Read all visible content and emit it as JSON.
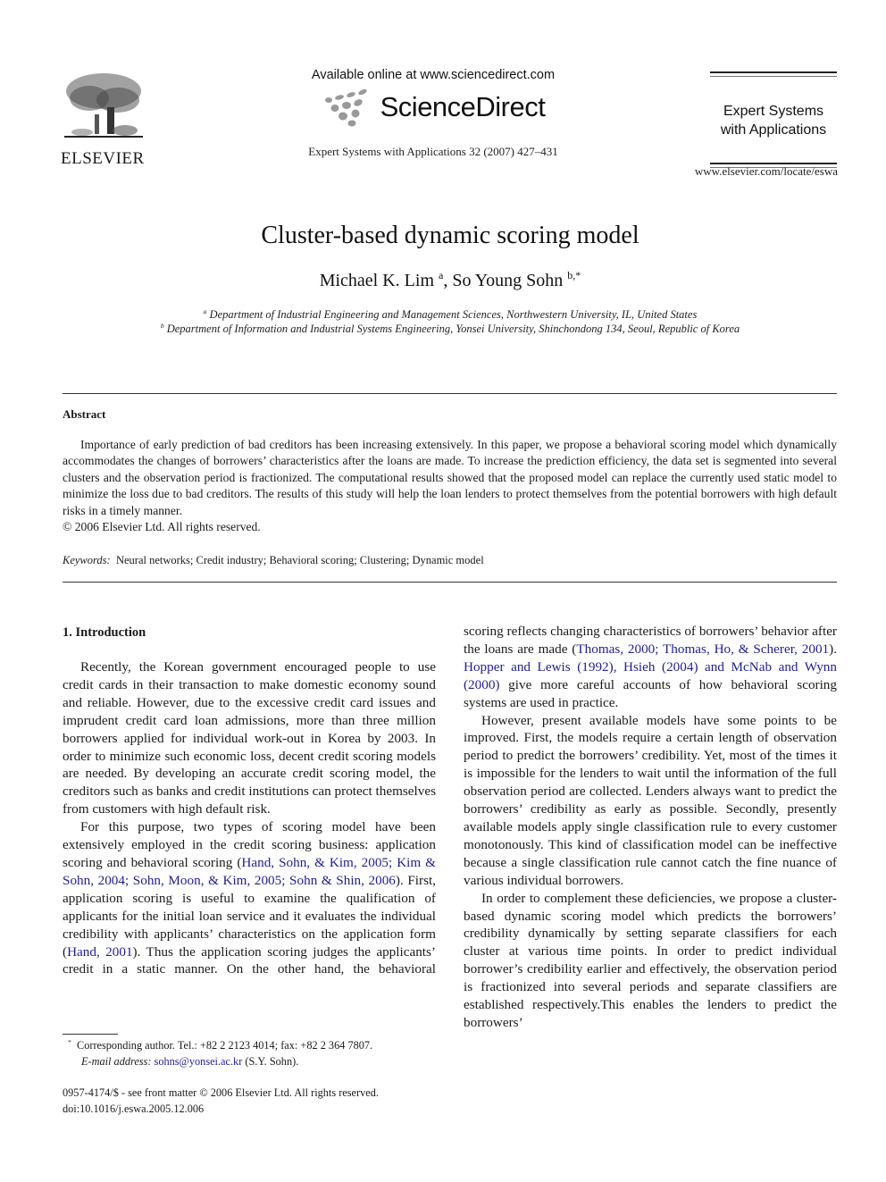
{
  "header": {
    "publisher_logo_text": "ELSEVIER",
    "logo_icon": "elsevier-tree-icon",
    "available_online": "Available online at www.sciencedirect.com",
    "sciencedirect_brand": "ScienceDirect",
    "sciencedirect_icon": "sciencedirect-dots-icon",
    "journal_citation": "Expert Systems with Applications 32 (2007) 427–431",
    "journal_title_line1": "Expert Systems",
    "journal_title_line2": "with Applications",
    "journal_url": "www.elsevier.com/locate/eswa"
  },
  "article": {
    "title": "Cluster-based dynamic scoring model",
    "authors": [
      {
        "name": "Michael K. Lim",
        "marks": "a"
      },
      {
        "name": "So Young Sohn",
        "marks": "b,*"
      }
    ],
    "author_separator": ", ",
    "affiliations": [
      {
        "mark": "a",
        "text": "Department of Industrial Engineering and Management Sciences, Northwestern University, IL, United States"
      },
      {
        "mark": "b",
        "text": "Department of Information and Industrial Systems Engineering, Yonsei University, Shinchondong 134, Seoul, Republic of Korea"
      }
    ]
  },
  "abstract": {
    "heading": "Abstract",
    "body": "Importance of early prediction of bad creditors has been increasing extensively. In this paper, we propose a behavioral scoring model which dynamically accommodates the changes of borrowers’ characteristics after the loans are made. To increase the prediction efficiency, the data set is segmented into several clusters and the observation period is fractionized. The computational results showed that the proposed model can replace the currently used static model to minimize the loss due to bad creditors. The results of this study will help the loan lenders to protect themselves from the potential borrowers with high default risks in a timely manner.",
    "copyright": "© 2006 Elsevier Ltd. All rights reserved.",
    "keywords_label": "Keywords:",
    "keywords": "Neural networks; Credit industry; Behavioral scoring; Clustering; Dynamic model"
  },
  "introduction": {
    "heading": "1. Introduction",
    "p1": "Recently, the Korean government encouraged people to use credit cards in their transaction to make domestic economy sound and reliable. However, due to the excessive credit card issues and imprudent credit card loan admissions, more than three million borrowers applied for individual work-out in Korea by 2003. In order to minimize such economic loss, decent credit scoring models are needed. By developing an accurate credit scoring model, the creditors such as banks and credit institutions can protect themselves from customers with high default risk.",
    "p2_a": "For this purpose, two types of scoring model have been extensively employed in the credit scoring business: application scoring and behavioral scoring (",
    "p2_cite1": "Hand, Sohn, & Kim, 2005; Kim & Sohn, 2004; Sohn, Moon, & Kim, 2005; Sohn & Shin, 2006",
    "p2_b": "). First, application scoring is useful to examine the qualification of applicants for the initial loan service and it evaluates the individual credibility with applicants’ characteristics on the application form (",
    "p2_cite2": "Hand, 2001",
    "p2_c": "). Thus the application scoring judges the applicants’ credit in a static manner. On the other hand, the behavioral scoring reflects changing characteristics of borrowers’ behavior after the loans are made (",
    "p2_cite3": "Thomas, 2000; Thomas, Ho, & Scherer, 2001",
    "p2_d": "). ",
    "p2_cite4": "Hopper and Lewis (1992), Hsieh (2004) and McNab and Wynn (2000)",
    "p2_e": " give more careful accounts of how behavioral scoring systems are used in practice.",
    "p3": "However, present available models have some points to be improved. First, the models require a certain length of observation period to predict the borrowers’ credibility. Yet, most of the times it is impossible for the lenders to wait until the information of the full observation period are collected. Lenders always want to predict the borrowers’ credibility as early as possible. Secondly, presently available models apply single classification rule to every customer monotonously. This kind of classification model can be ineffective because a single classification rule cannot catch the fine nuance of various individual borrowers.",
    "p4": "In order to complement these deficiencies, we propose a cluster-based dynamic scoring model which predicts the borrowers’ credibility dynamically by setting separate classifiers for each cluster at various time points. In order to predict individual borrower’s credibility earlier and effectively, the observation period is fractionized into several periods and separate classifiers are established respectively.This enables the lenders to predict the borrowers’"
  },
  "footnote": {
    "mark": "*",
    "text": "Corresponding author. Tel.: +82 2 2123 4014; fax: +82 2 364 7807.",
    "email_label": "E-mail address:",
    "email": "sohns@yonsei.ac.kr",
    "email_suffix": " (S.Y. Sohn)."
  },
  "front_matter": {
    "issn_line": "0957-4174/$ - see front matter © 2006 Elsevier Ltd. All rights reserved.",
    "doi": "doi:10.1016/j.eswa.2005.12.006"
  },
  "colors": {
    "link": "#1f1f8f",
    "text": "#1a1a1a"
  }
}
